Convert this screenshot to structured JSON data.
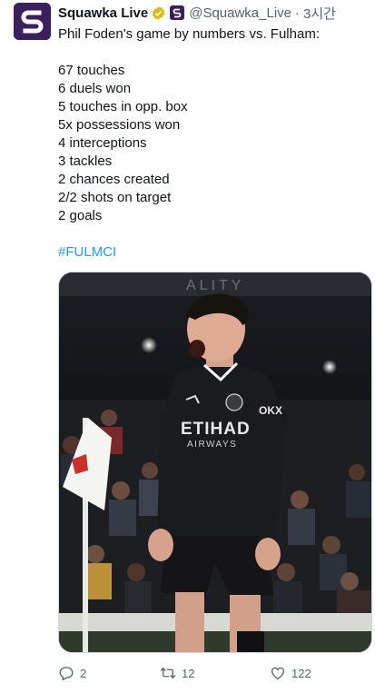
{
  "tweet": {
    "display_name": "Squawka Live",
    "handle": "@Squawka_Live",
    "separator": "·",
    "time": "3시간",
    "lines": [
      "Phil Foden's game by numbers vs. Fulham:",
      "",
      "67 touches",
      "6 duels won",
      "5 touches in opp. box",
      "5x possessions won",
      "4 interceptions",
      "3 tackles",
      "2 chances created",
      "2/2 shots on target",
      "2 goals",
      ""
    ],
    "hashtag": "#FULMCI",
    "media": {
      "kit_sponsor": "ETIHAD",
      "kit_sponsor_sub": "AIRWAYS",
      "sleeve_text": "OKX",
      "stand_text": "ALITY"
    },
    "stats": {
      "replies": "2",
      "retweets": "12",
      "likes": "122"
    }
  },
  "icons": {
    "avatar": "squawka-logo-icon",
    "verified": "verified-gold-icon",
    "affiliate": "affiliate-badge-icon",
    "reply": "reply-icon",
    "retweet": "retweet-icon",
    "like": "heart-icon"
  },
  "colors": {
    "link": "#1d9bf0",
    "secondary_text": "#536471",
    "brand_purple": "#3b1f5e",
    "verified_gold": "#e2b719"
  }
}
